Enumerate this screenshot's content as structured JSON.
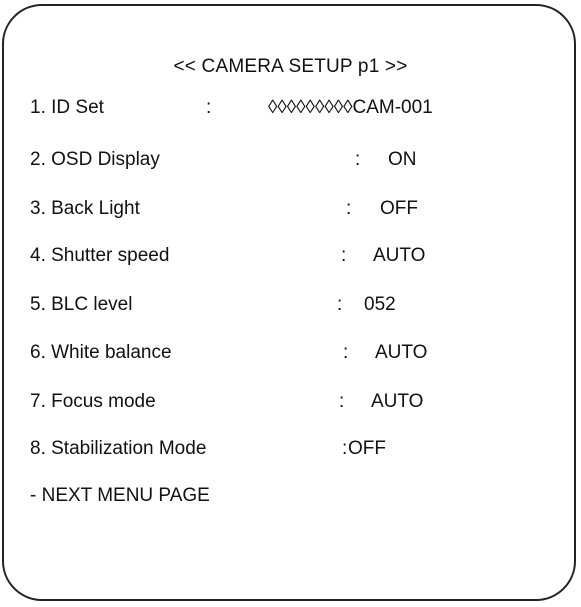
{
  "menu": {
    "title": "<< CAMERA SETUP p1 >>",
    "items": [
      {
        "label": "1. ID Set",
        "separator": ":",
        "value": "◊◊◊◊◊◊◊◊◊CAM-001"
      },
      {
        "label": "2. OSD Display",
        "separator": ":",
        "value": "ON"
      },
      {
        "label": "3. Back Light",
        "separator": ":",
        "value": "OFF"
      },
      {
        "label": "4. Shutter speed",
        "separator": ":",
        "value": "AUTO"
      },
      {
        "label": "5. BLC level",
        "separator": ":",
        "value": "052"
      },
      {
        "label": "6. White balance",
        "separator": ":",
        "value": "AUTO"
      },
      {
        "label": "7. Focus mode",
        "separator": ":",
        "value": "AUTO"
      },
      {
        "label": "8. Stabilization Mode",
        "separator": ":",
        "value": "OFF"
      }
    ],
    "next_page_label": "- NEXT MENU PAGE"
  }
}
